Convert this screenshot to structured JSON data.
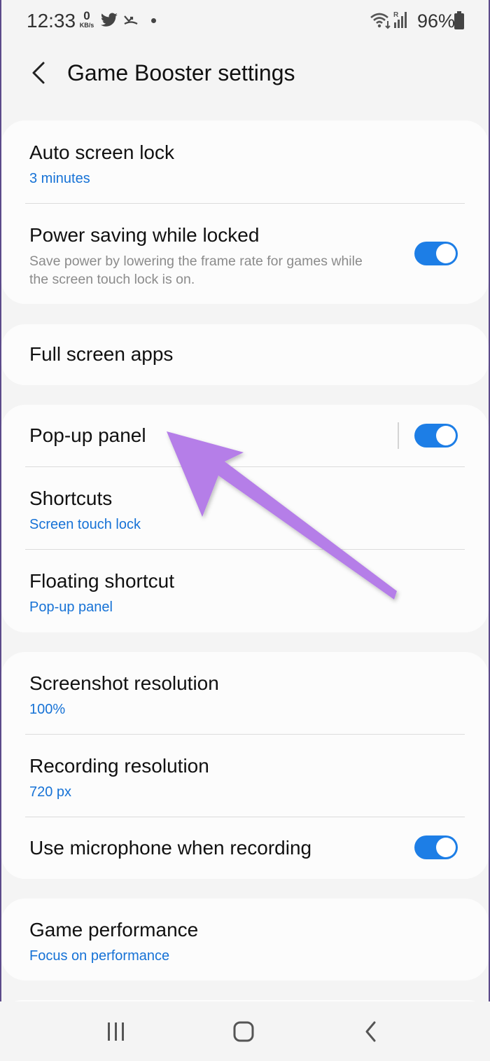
{
  "status_bar": {
    "time": "12:33",
    "net_speed_value": "0",
    "net_speed_unit": "KB/s",
    "battery": "96%",
    "icons": [
      "twitter-icon",
      "missed-call-icon",
      "dot-icon",
      "wifi-icon",
      "signal-icon",
      "battery-icon"
    ]
  },
  "header": {
    "title": "Game Booster settings",
    "back_icon": "back-arrow-icon"
  },
  "sections": {
    "auto_lock": {
      "title": "Auto screen lock",
      "value": "3 minutes"
    },
    "power_saving": {
      "title": "Power saving while locked",
      "description": "Save power by lowering the frame rate for games while the screen touch lock is on.",
      "enabled": true
    },
    "full_screen": {
      "title": "Full screen apps"
    },
    "popup_panel": {
      "title": "Pop-up panel",
      "enabled": true
    },
    "shortcuts": {
      "title": "Shortcuts",
      "value": "Screen touch lock"
    },
    "floating": {
      "title": "Floating shortcut",
      "value": "Pop-up panel"
    },
    "screenshot_res": {
      "title": "Screenshot resolution",
      "value": "100%"
    },
    "recording_res": {
      "title": "Recording resolution",
      "value": "720 px"
    },
    "microphone": {
      "title": "Use microphone when recording",
      "enabled": true
    },
    "performance": {
      "title": "Game performance",
      "value": "Focus on performance"
    }
  },
  "nav_bar": {
    "icons": [
      "recent-apps-icon",
      "home-icon",
      "back-icon"
    ]
  },
  "colors": {
    "accent": "#1d7ee6",
    "subtitle": "#1672d6",
    "background": "#f4f4f4",
    "card": "#fcfcfc",
    "annotation_arrow": "#b57ee8"
  }
}
